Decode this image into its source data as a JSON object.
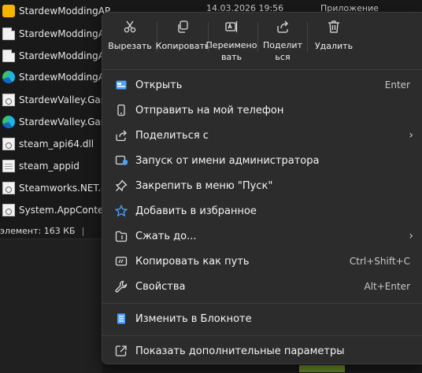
{
  "explorer": {
    "files": [
      {
        "name": "StardewModdingAPI",
        "icon": "package-icon"
      },
      {
        "name": "StardewModdingAPI",
        "icon": "document-icon"
      },
      {
        "name": "StardewModdingAPI",
        "icon": "document-icon"
      },
      {
        "name": "StardewModdingAPI",
        "icon": "edge-icon"
      },
      {
        "name": "StardewValley.Game",
        "icon": "config-icon"
      },
      {
        "name": "StardewValley.Game",
        "icon": "edge-icon"
      },
      {
        "name": "steam_api64.dll",
        "icon": "config-icon"
      },
      {
        "name": "steam_appid",
        "icon": "text-file-icon"
      },
      {
        "name": "Steamworks.NET.dll",
        "icon": "config-icon"
      },
      {
        "name": "System.AppContext.",
        "icon": "config-icon"
      }
    ],
    "top_row_date": "14.03.2026 19:56",
    "top_row_type": "Приложение",
    "status_text": "элемент: 163 КБ",
    "status_separator": "|"
  },
  "menu": {
    "quick_actions": [
      {
        "label": "Вырезать",
        "icon": "scissors-icon"
      },
      {
        "label": "Копировать",
        "icon": "copy-icon"
      },
      {
        "label": "Переименовать",
        "icon": "rename-icon"
      },
      {
        "label": "Поделиться",
        "icon": "share-icon"
      },
      {
        "label": "Удалить",
        "icon": "trash-icon"
      }
    ],
    "items": [
      {
        "label": "Открыть",
        "shortcut": "Enter",
        "icon": "open-icon"
      },
      {
        "label": "Отправить на мой телефон",
        "shortcut": "",
        "icon": "phone-icon"
      },
      {
        "label": "Поделиться с",
        "shortcut": "",
        "icon": "share-with-icon",
        "submenu": true
      },
      {
        "label": "Запуск от имени администратора",
        "shortcut": "",
        "icon": "admin-shield-icon"
      },
      {
        "label": "Закрепить в меню \"Пуск\"",
        "shortcut": "",
        "icon": "pin-icon"
      },
      {
        "label": "Добавить в избранное",
        "shortcut": "",
        "icon": "star-icon"
      },
      {
        "label": "Сжать до...",
        "shortcut": "",
        "icon": "archive-icon",
        "submenu": true
      },
      {
        "label": "Копировать как путь",
        "shortcut": "Ctrl+Shift+C",
        "icon": "copy-path-icon"
      },
      {
        "label": "Свойства",
        "shortcut": "Alt+Enter",
        "icon": "wrench-icon"
      },
      {
        "label": "Изменить в Блокноте",
        "shortcut": "",
        "icon": "notepad-icon"
      },
      {
        "label": "Показать дополнительные параметры",
        "shortcut": "",
        "icon": "more-options-icon"
      }
    ],
    "submenu_arrow": "›"
  },
  "colors": {
    "menu_bg": "#2c2c2c",
    "notepad_blue": "#4aa3ff",
    "favorite_star": "#4aa3ff"
  }
}
